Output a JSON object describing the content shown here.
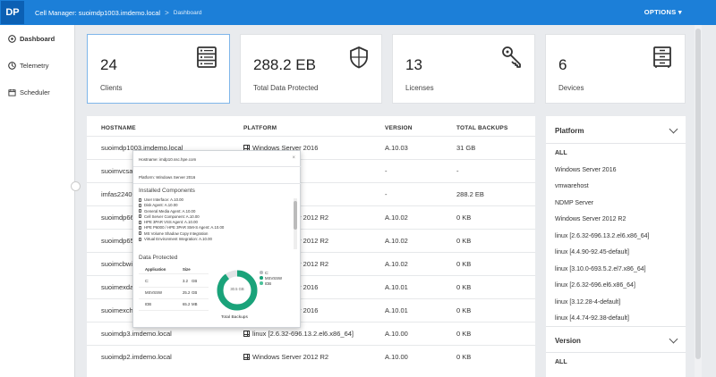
{
  "header": {
    "logo": "DP",
    "cell_manager": "Cell Manager: suoimdp1003.imdemo.local",
    "separator": ">",
    "breadcrumb": "Dashboard",
    "options": "OPTIONS ▾",
    "bg_color": "#1c7fd8"
  },
  "sidebar": {
    "items": [
      {
        "label": "Dashboard",
        "icon": "dashboard-icon",
        "active": true
      },
      {
        "label": "Telemetry",
        "icon": "telemetry-icon",
        "active": false
      },
      {
        "label": "Scheduler",
        "icon": "scheduler-icon",
        "active": false
      }
    ]
  },
  "cards": [
    {
      "value": "24",
      "label": "Clients",
      "icon": "server-list-icon"
    },
    {
      "value": "288.2 EB",
      "label": "Total Data Protected",
      "icon": "shield-icon"
    },
    {
      "value": "13",
      "label": "Licenses",
      "icon": "key-icon"
    },
    {
      "value": "6",
      "label": "Devices",
      "icon": "cabinet-icon"
    }
  ],
  "table": {
    "columns": [
      "HOSTNAME",
      "PLATFORM",
      "VERSION",
      "TOTAL BACKUPS"
    ],
    "rows": [
      [
        "suoimdp1003.imdemo.local",
        "Windows Server 2016",
        "A.10.03",
        "31 GB"
      ],
      [
        "suoimvcsa1",
        "",
        "-",
        "-"
      ],
      [
        "imfas2240-",
        "",
        "-",
        "288.2 EB"
      ],
      [
        "suoimdp66",
        "Windows Server 2012 R2",
        "A.10.02",
        "0 KB"
      ],
      [
        "suoimdp65",
        "Windows Server 2012 R2",
        "A.10.02",
        "0 KB"
      ],
      [
        "suoimcbwin",
        "Windows Server 2012 R2",
        "A.10.02",
        "0 KB"
      ],
      [
        "suoimexdag",
        "Windows Server 2016",
        "A.10.01",
        "0 KB"
      ],
      [
        "suoimexcha",
        "Windows Server 2016",
        "A.10.01",
        "0 KB"
      ],
      [
        "suoimdp3.imdemo.local",
        "linux [2.6.32-696.13.2.el6.x86_64]",
        "A.10.00",
        "0 KB"
      ],
      [
        "suoimdp2.imdemo.local",
        "Windows Server 2012 R2",
        "A.10.00",
        "0 KB"
      ]
    ]
  },
  "popup": {
    "hostname": "Hostname: imdp10.ssc.hpe.com",
    "close": "×",
    "platform": "Platform: Windows Server 2016",
    "installed_title": "Installed Components",
    "components": [
      "User Interface: A.10.00",
      "Disk Agent: A.10.00",
      "General Media Agent: A.10.00",
      "Cell Server Component: A.10.00",
      "HPE 3PAR VSS Agent: A.10.00",
      "HPE P6000 / HPE 3PAR SMI-S Agent: A.10.00",
      "MS Volume Shadow Copy Integration",
      "Virtual Environment Integration: A.10.00"
    ],
    "data_title": "Data Protected",
    "dp_headers": [
      "Application",
      "Size"
    ],
    "dp_rows": [
      [
        "C:",
        "3.2",
        "GB"
      ],
      [
        "MSVSSW",
        "25.2",
        "GB"
      ],
      [
        "IDB",
        "65.2",
        "MB"
      ]
    ],
    "legend": [
      {
        "name": "C:",
        "color": "#b8bcc0"
      },
      {
        "name": "MSVSSW",
        "color": "#1aa37a"
      },
      {
        "name": "IDB",
        "color": "#4cc19a"
      }
    ],
    "donut_center": "30.5 GB",
    "total_label": "Total Backups"
  },
  "filter": {
    "platform_title": "Platform",
    "platform_items": [
      "ALL",
      "Windows Server 2016",
      "vmwarehost",
      "NDMP Server",
      "Windows Server 2012 R2",
      "linux [2.6.32-696.13.2.el6.x86_64]",
      "linux [4.4.90-92.45-default]",
      "linux [3.10.0-693.5.2.el7.x86_64]",
      "linux [2.6.32-696.el6.x86_64]",
      "linux [3.12.28-4-default]",
      "linux [4.4.74-92.38-default]"
    ],
    "version_title": "Version",
    "version_items": [
      "ALL"
    ]
  }
}
